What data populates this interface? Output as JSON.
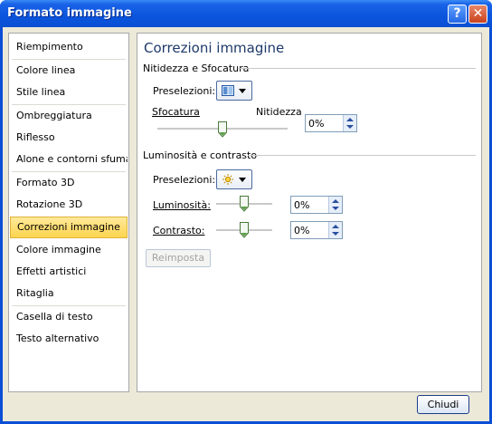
{
  "window": {
    "title": "Formato immagine"
  },
  "titlebar": {
    "help_glyph": "?",
    "close_glyph": "✕"
  },
  "sidebar": {
    "items": [
      {
        "label": "Riempimento"
      },
      {
        "label": "Colore linea"
      },
      {
        "label": "Stile linea"
      },
      {
        "label": "Ombreggiatura"
      },
      {
        "label": "Riflesso"
      },
      {
        "label": "Alone e contorni sfumati"
      },
      {
        "label": "Formato 3D"
      },
      {
        "label": "Rotazione 3D"
      },
      {
        "label": "Correzioni immagine"
      },
      {
        "label": "Colore immagine"
      },
      {
        "label": "Effetti artistici"
      },
      {
        "label": "Ritaglia"
      },
      {
        "label": "Casella di testo"
      },
      {
        "label": "Testo alternativo"
      }
    ],
    "selected": "Correzioni immagine"
  },
  "panel": {
    "title": "Correzioni immagine",
    "sharpness": {
      "heading": "Nitidezza e Sfocatura",
      "presets_label": "Preselezioni:",
      "blur_label": "Sfocatura",
      "sharpen_label": "Nitidezza",
      "value": "0%"
    },
    "brightness_contrast": {
      "heading": "Luminosità e contrasto",
      "presets_label": "Preselezioni:",
      "brightness_label": "Luminosità:",
      "brightness_value": "0%",
      "contrast_label": "Contrasto:",
      "contrast_value": "0%"
    },
    "reset_label": "Reimposta"
  },
  "footer": {
    "close_label": "Chiudi"
  },
  "icons": {
    "sharpness_preset": "sharpness-preset-icon",
    "brightness_preset": "sun-icon"
  },
  "colors": {
    "title_bar": "#0a55dd",
    "selection": "#ffd54f",
    "panel_title": "#1e3a6a"
  }
}
